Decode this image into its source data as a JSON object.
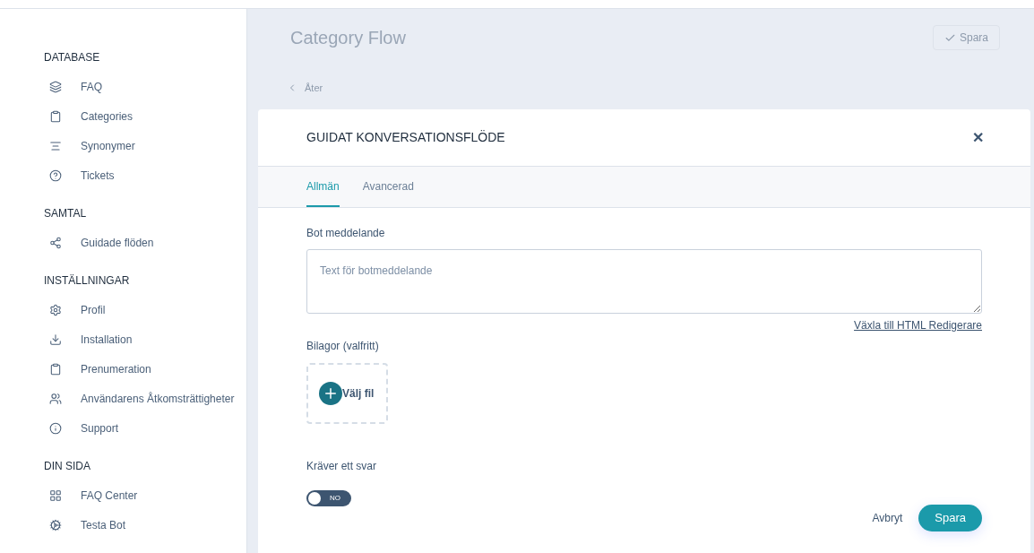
{
  "sidebar": {
    "sections": [
      {
        "heading": "DATABASE",
        "items": [
          {
            "label": "FAQ"
          },
          {
            "label": "Categories"
          },
          {
            "label": "Synonymer"
          },
          {
            "label": "Tickets"
          }
        ]
      },
      {
        "heading": "SAMTAL",
        "items": [
          {
            "label": "Guidade flöden"
          }
        ]
      },
      {
        "heading": "INSTÄLLNINGAR",
        "items": [
          {
            "label": "Profil"
          },
          {
            "label": "Installation"
          },
          {
            "label": "Prenumeration"
          },
          {
            "label": "Användarens Åtkomsträttigheter"
          },
          {
            "label": "Support"
          }
        ]
      },
      {
        "heading": "DIN SIDA",
        "items": [
          {
            "label": "FAQ Center"
          },
          {
            "label": "Testa Bot"
          }
        ]
      }
    ]
  },
  "page": {
    "title": "Category Flow",
    "save_button": "Spara",
    "back_link": "Åter"
  },
  "modal": {
    "title": "GUIDAT KONVERSATIONSFLÖDE",
    "close": "✕",
    "tabs": [
      {
        "label": "Allmän",
        "selected": true
      },
      {
        "label": "Avancerad",
        "selected": false
      }
    ],
    "bot_message": {
      "label": "Bot meddelande",
      "placeholder": "Text för botmeddelande"
    },
    "html_link": "Växla till HTML Redigerare",
    "attachments": {
      "label": "Bilagor (valfritt)",
      "button": "Välj fil"
    },
    "requires_answer": {
      "label": "Kräver ett svar",
      "on": false,
      "toggle_text": "NO"
    },
    "cancel": "Avbryt",
    "save": "Spara"
  }
}
